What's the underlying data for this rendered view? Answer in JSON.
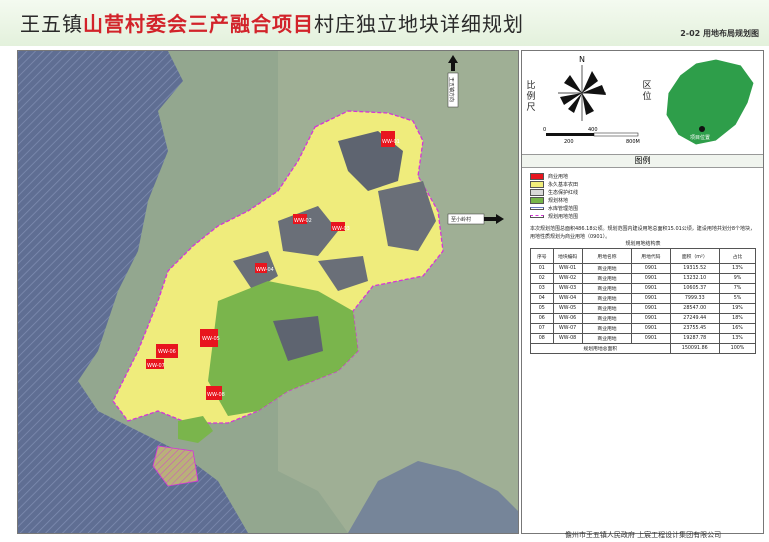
{
  "header": {
    "title_part1": "王五镇",
    "title_part2": "山营村委会三产融合项目",
    "title_part3": "村庄独立地块详细规划",
    "subtitle": "2-02  用地布局规划图"
  },
  "colors": {
    "water": "#5f6e93",
    "terrain": "#8ea38a",
    "commercial": "#e8151e",
    "farmland": "#f1ee7a",
    "ecological": "#d9d9d9",
    "forest": "#77b64a",
    "boundary": "#d634d9"
  },
  "map": {
    "places": [
      "王五镇方向",
      "至小岭村"
    ],
    "lot_labels": [
      "WW-01",
      "WW-02",
      "WW-03",
      "WW-04",
      "WW-05",
      "WW-06",
      "WW-07",
      "WW-08"
    ]
  },
  "panel": {
    "scale_label": "比例尺",
    "location_label": "区位",
    "compass_icon": "north-compass-icon",
    "scale_ticks": [
      "0",
      "200",
      "400",
      "800M"
    ],
    "site_label": "项目位置",
    "legend_title": "图例",
    "legend": [
      {
        "label": "商业用地",
        "color": "#e8151e"
      },
      {
        "label": "永久基本农田",
        "color": "#f1ee7a"
      },
      {
        "label": "生态保护红线",
        "color": "#d9d9d9"
      },
      {
        "label": "规划林地",
        "color": "#77b64a"
      },
      {
        "label": "水库管理范围",
        "color": "#6b7fc4"
      },
      {
        "label": "规划用地范围",
        "color": "#d634d9"
      }
    ],
    "note": "本次规划范围总面积486.18公顷。规划范围内建设用地总面积15.01公顷，建设用地共划分8个地块，用地性质规划为商业用地（0901）。",
    "table": {
      "caption": "规划用地结构表",
      "headers": [
        "序号",
        "地块编码",
        "用地名称",
        "用地代码",
        "面积（m²）",
        "占比"
      ],
      "rows": [
        [
          "01",
          "WW-01",
          "商业用地",
          "0901",
          "19315.52",
          "13%"
        ],
        [
          "02",
          "WW-02",
          "商业用地",
          "0901",
          "13232.10",
          "9%"
        ],
        [
          "03",
          "WW-03",
          "商业用地",
          "0901",
          "10605.37",
          "7%"
        ],
        [
          "04",
          "WW-04",
          "商业用地",
          "0901",
          "7999.33",
          "5%"
        ],
        [
          "05",
          "WW-05",
          "商业用地",
          "0901",
          "28547.00",
          "19%"
        ],
        [
          "06",
          "WW-06",
          "商业用地",
          "0901",
          "27249.44",
          "18%"
        ],
        [
          "07",
          "WW-07",
          "商业用地",
          "0901",
          "23755.45",
          "16%"
        ],
        [
          "08",
          "WW-08",
          "商业用地",
          "0901",
          "19287.78",
          "13%"
        ]
      ],
      "total_label": "规划用地总面积",
      "total_area": "150091.86",
      "total_pct": "100%"
    }
  },
  "footer": "儋州市王五镇人民政府    上宸工程设计集团有限公司"
}
